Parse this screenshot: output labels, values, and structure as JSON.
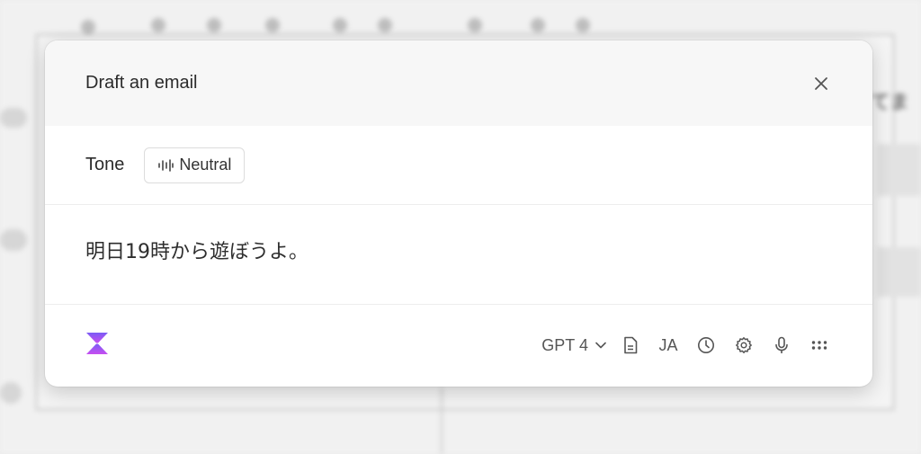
{
  "background": {
    "partial_text": "てま"
  },
  "dialog": {
    "title": "Draft an email",
    "tone": {
      "label": "Tone",
      "value": "Neutral",
      "icon": "waveform-icon"
    },
    "message": "明日19時から遊ぼうよ。",
    "footer": {
      "logo": "hourglass-logo",
      "model": "GPT 4",
      "language": "JA",
      "icons": [
        "document-icon",
        "clock-icon",
        "gear-icon",
        "microphone-icon",
        "grid-dots-icon"
      ]
    }
  },
  "colors": {
    "logo_top": "#7b5cf5",
    "logo_bottom": "#c74ef0",
    "header_bg": "#f7f7f7"
  }
}
